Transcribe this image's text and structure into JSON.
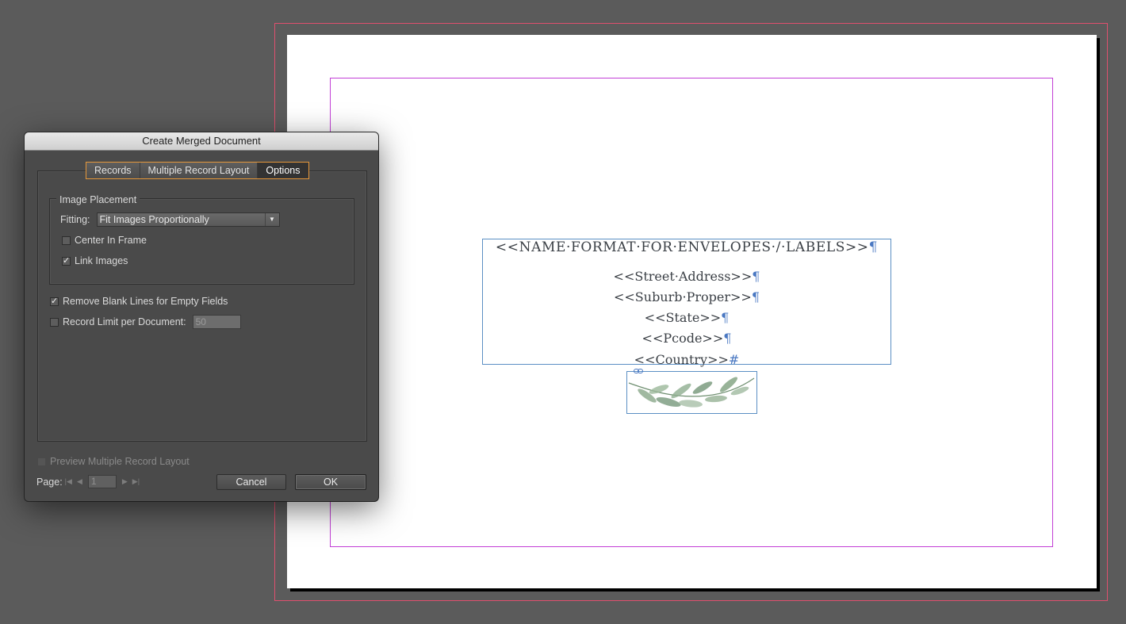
{
  "document": {
    "lines": [
      "<<NAME·FORMAT·FOR·ENVELOPES·/·LABELS>>",
      "<<Street·Address>>",
      "<<Suburb·Proper>>",
      "<<State>>",
      "<<Pcode>>",
      "<<Country>>"
    ],
    "pilcrow": "¶",
    "end_mark": "#"
  },
  "dialog": {
    "title": "Create Merged Document",
    "tabs": [
      "Records",
      "Multiple Record Layout",
      "Options"
    ],
    "active_tab": "Options",
    "image_placement": {
      "group_label": "Image Placement",
      "fitting_label": "Fitting:",
      "fitting_value": "Fit Images Proportionally",
      "center_in_frame": {
        "label": "Center In Frame",
        "checked": false
      },
      "link_images": {
        "label": "Link Images",
        "checked": true
      }
    },
    "remove_blank_lines": {
      "label": "Remove Blank Lines for Empty Fields",
      "checked": true
    },
    "record_limit": {
      "label": "Record Limit per Document:",
      "checked": false,
      "value": "50"
    },
    "preview": {
      "label": "Preview Multiple Record Layout",
      "checked": false
    },
    "page_label": "Page:",
    "page_value": "1",
    "cancel_label": "Cancel",
    "ok_label": "OK"
  }
}
